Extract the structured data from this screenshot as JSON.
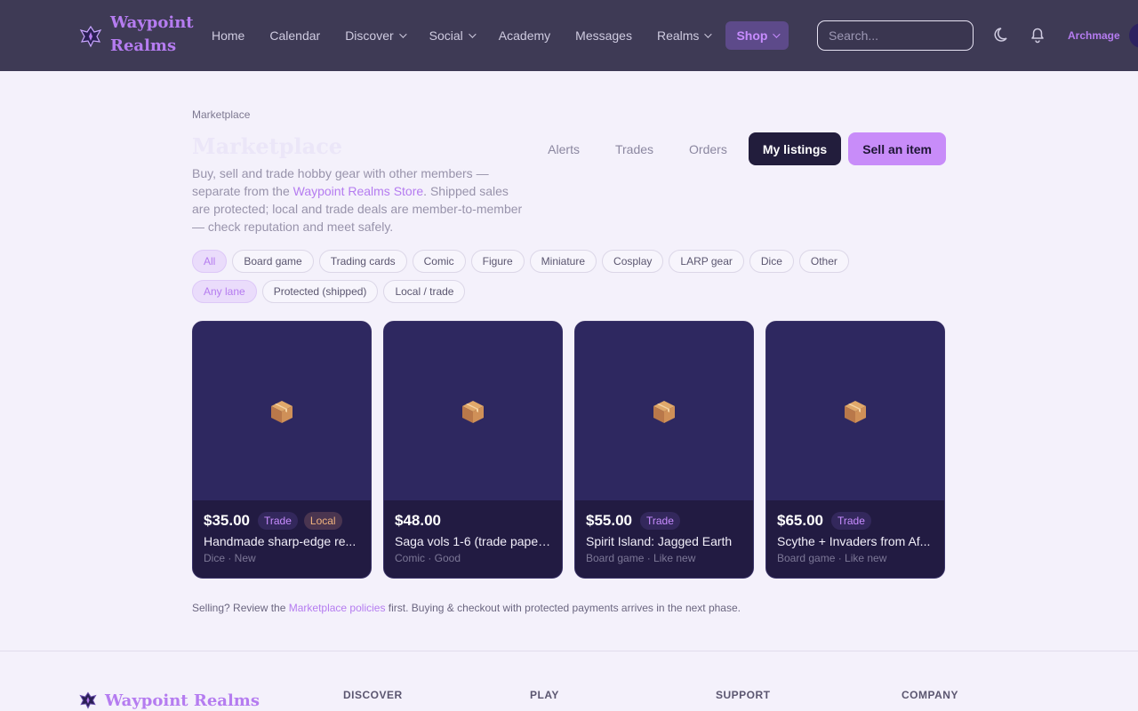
{
  "header": {
    "brand": "Waypoint Realms",
    "nav": [
      {
        "label": "Home",
        "dropdown": false
      },
      {
        "label": "Calendar",
        "dropdown": false
      },
      {
        "label": "Discover",
        "dropdown": true
      },
      {
        "label": "Social",
        "dropdown": true
      },
      {
        "label": "Academy",
        "dropdown": false
      },
      {
        "label": "Messages",
        "dropdown": false
      },
      {
        "label": "Realms",
        "dropdown": true
      }
    ],
    "shop_label": "Shop",
    "search_placeholder": "Search...",
    "user_name": "Archmage"
  },
  "main": {
    "breadcrumb": "Marketplace",
    "title": "Marketplace",
    "intro_before": "Buy, sell and trade hobby gear with other members — separate from the ",
    "intro_link": "Waypoint Realms Store",
    "intro_after": ". Shipped sales are protected; local and trade deals are member-to-member — check reputation and meet safely.",
    "tabs": {
      "alerts": "Alerts",
      "trades": "Trades",
      "orders": "Orders",
      "my_listings": "My listings",
      "sell": "Sell an item"
    },
    "category_filters": [
      "All",
      "Board game",
      "Trading cards",
      "Comic",
      "Figure",
      "Miniature",
      "Cosplay",
      "LARP gear",
      "Dice",
      "Other"
    ],
    "lane_filters": [
      "Any lane",
      "Protected (shipped)",
      "Local / trade"
    ],
    "listings": [
      {
        "price": "$35.00",
        "badges": [
          "Trade",
          "Local"
        ],
        "title": "Handmade sharp-edge re...",
        "meta": "Dice · New"
      },
      {
        "price": "$48.00",
        "badges": [],
        "title": "Saga vols 1-6 (trade paper...",
        "meta": "Comic · Good"
      },
      {
        "price": "$55.00",
        "badges": [
          "Trade"
        ],
        "title": "Spirit Island: Jagged Earth",
        "meta": "Board game · Like new"
      },
      {
        "price": "$65.00",
        "badges": [
          "Trade"
        ],
        "title": "Scythe + Invaders from Af...",
        "meta": "Board game · Like new"
      }
    ],
    "note_before": "Selling? Review the ",
    "note_link": "Marketplace policies",
    "note_after": " first. Buying & checkout with protected payments arrives in the next phase."
  },
  "footer": {
    "brand": "Waypoint Realms",
    "columns": [
      "DISCOVER",
      "PLAY",
      "SUPPORT",
      "COMPANY"
    ]
  },
  "colors": {
    "header_bg": "#3e3a55",
    "accent": "#b57cf0",
    "card_bg": "#241d45"
  },
  "icons": [
    "logo-emblem-icon",
    "moon-icon",
    "bell-icon",
    "package-icon"
  ]
}
